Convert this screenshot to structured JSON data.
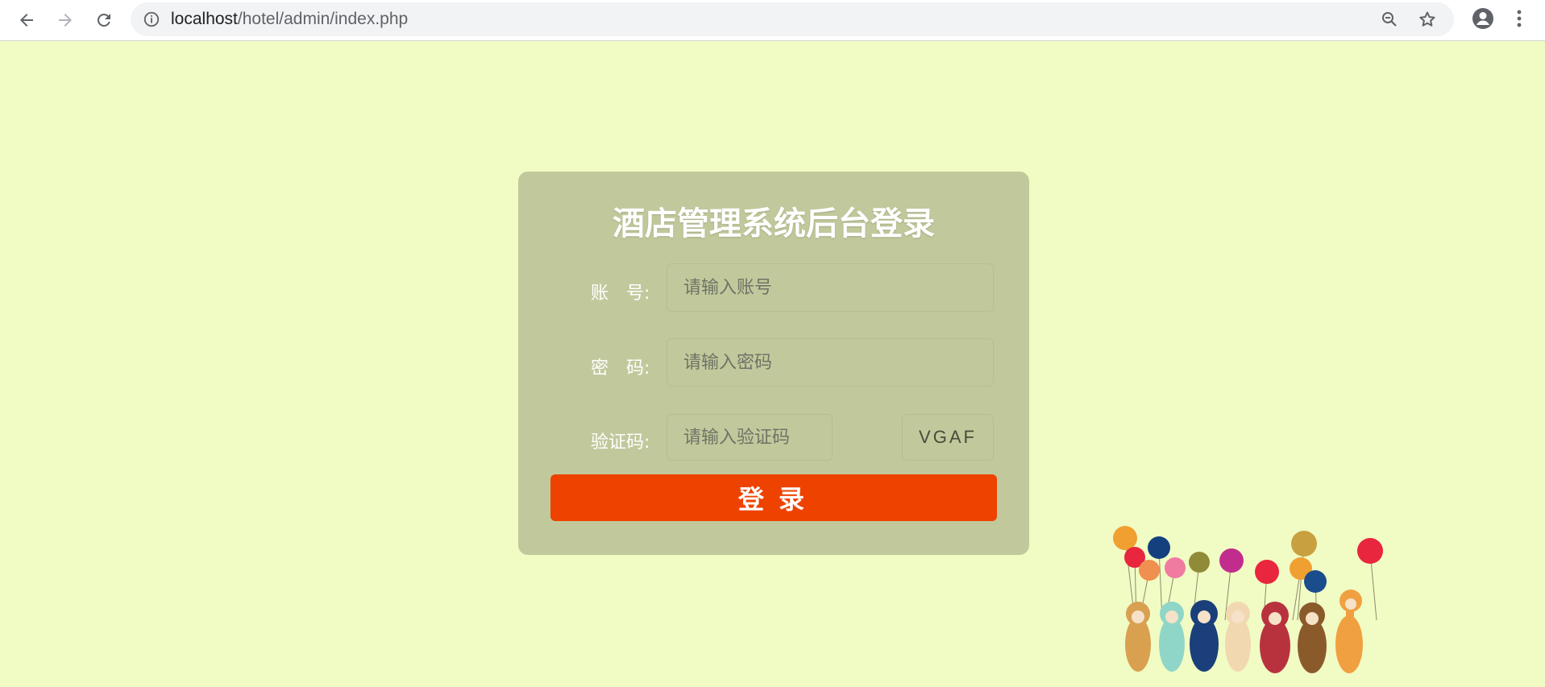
{
  "browser": {
    "url_host": "localhost",
    "url_path": "/hotel/admin/index.php"
  },
  "login": {
    "title": "酒店管理系统后台登录",
    "account_label": "账　号:",
    "account_placeholder": "请输入账号",
    "password_label": "密　码:",
    "password_placeholder": "请输入密码",
    "captcha_label": "验证码:",
    "captcha_placeholder": "请输入验证码",
    "captcha_code": "VGAF",
    "submit_label": "登录"
  },
  "colors": {
    "page_bg": "#f1fbc4",
    "panel_bg": "#c1c99c",
    "button_bg": "#ee4200"
  }
}
